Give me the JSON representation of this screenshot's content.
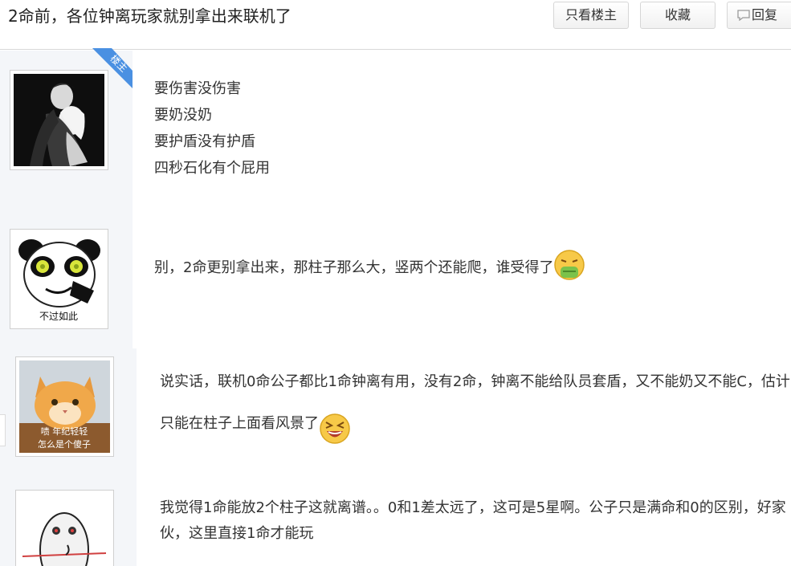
{
  "header": {
    "title": "2命前，各位钟离玩家就别拿出来联机了",
    "buttons": {
      "only_op": "只看楼主",
      "favorite": "收藏",
      "reply": "回复"
    }
  },
  "op_badge": "楼主",
  "posts": [
    {
      "avatar_icon": "couple-photo-avatar",
      "lines": [
        "要伤害没伤害",
        "要奶没奶",
        "要护盾没有护盾",
        "四秒石化有个屁用"
      ]
    },
    {
      "avatar_icon": "panda-meme-avatar",
      "avatar_caption": "不过如此",
      "text": "别，2命更别拿出来，那柱子那么大，竖两个还能爬，谁受得了",
      "emoji": "vomit-emoji"
    },
    {
      "avatar_icon": "cat-meme-avatar",
      "avatar_caption_lines": [
        "啧 年纪轻轻",
        "怎么是个傻子"
      ],
      "text": "说实话，联机0命公子都比1命钟离有用，没有2命，钟离不能给队员套盾，又不能奶又不能C，估计只能在柱子上面看风景了",
      "emoji": "laughing-emoji"
    },
    {
      "avatar_icon": "seal-meme-avatar",
      "text": "我觉得1命能放2个柱子这就离谱。。0和1差太远了，这可是5星啊。公子只是满命和0的区别，好家伙，这里直接1命才能玩"
    }
  ]
}
